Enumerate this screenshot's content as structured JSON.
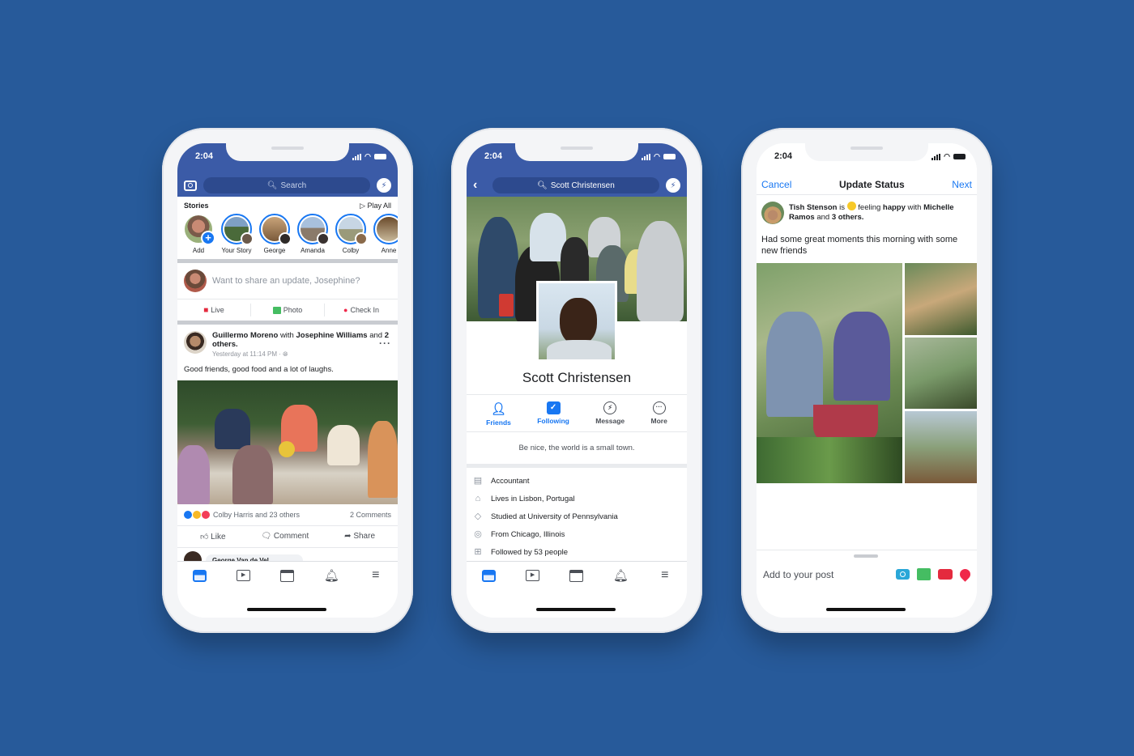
{
  "colors": {
    "background": "#275a9a",
    "fb_blue": "#3b5ba7",
    "accent": "#1877f2",
    "live": "#e42a3e",
    "photo": "#45bd62",
    "checkin": "#f0284a"
  },
  "phones": {
    "feed": {
      "status_time": "2:04",
      "search_placeholder": "Search",
      "stories_label": "Stories",
      "play_all": "Play All",
      "stories": [
        {
          "name": "Add"
        },
        {
          "name": "Your Story"
        },
        {
          "name": "George"
        },
        {
          "name": "Amanda"
        },
        {
          "name": "Colby"
        },
        {
          "name": "Anne"
        }
      ],
      "composer_prompt": "Want to share an update, Josephine?",
      "composer_actions": [
        {
          "label": "Live"
        },
        {
          "label": "Photo"
        },
        {
          "label": "Check In"
        }
      ],
      "post": {
        "author": "Guillermo Moreno",
        "with_text": "with",
        "tagged": "Josephine Williams",
        "and_text": "and",
        "others": "2 others.",
        "timestamp": "Yesterday at 11:14 PM · ",
        "text": "Good friends, good food and a lot of laughs.",
        "reactions_text": "Colby Harris and 23 others",
        "comments_count": "2 Comments",
        "buttons": [
          {
            "label": "Like"
          },
          {
            "label": "Comment"
          },
          {
            "label": "Share"
          }
        ],
        "comment_author": "George Van de Vel"
      }
    },
    "profile": {
      "status_time": "2:04",
      "search_value": "Scott Christensen",
      "name": "Scott Christensen",
      "buttons": [
        {
          "label": "Friends"
        },
        {
          "label": "Following"
        },
        {
          "label": "Message"
        },
        {
          "label": "More"
        }
      ],
      "bio": "Be nice, the world is a small town.",
      "info": [
        {
          "icon": "briefcase-icon",
          "text": "Accountant"
        },
        {
          "icon": "home-icon",
          "text": "Lives in Lisbon, Portugal"
        },
        {
          "icon": "graduation-cap-icon",
          "text": "Studied at University of Pennsylvania"
        },
        {
          "icon": "location-pin-icon",
          "text": "From Chicago, Illinois"
        },
        {
          "icon": "followers-icon",
          "text": "Followed by 53 people"
        }
      ]
    },
    "update": {
      "status_time": "2:04",
      "cancel": "Cancel",
      "title": "Update Status",
      "next": "Next",
      "user": "Tish Stenson",
      "is_text": "is",
      "feeling_text": "feeling",
      "feeling": "happy",
      "with_text": "with",
      "tagged": "Michelle Ramos",
      "and_text": "and",
      "others": "3 others.",
      "text": "Had some great moments this morning with some new friends",
      "add_label": "Add to your post"
    }
  }
}
